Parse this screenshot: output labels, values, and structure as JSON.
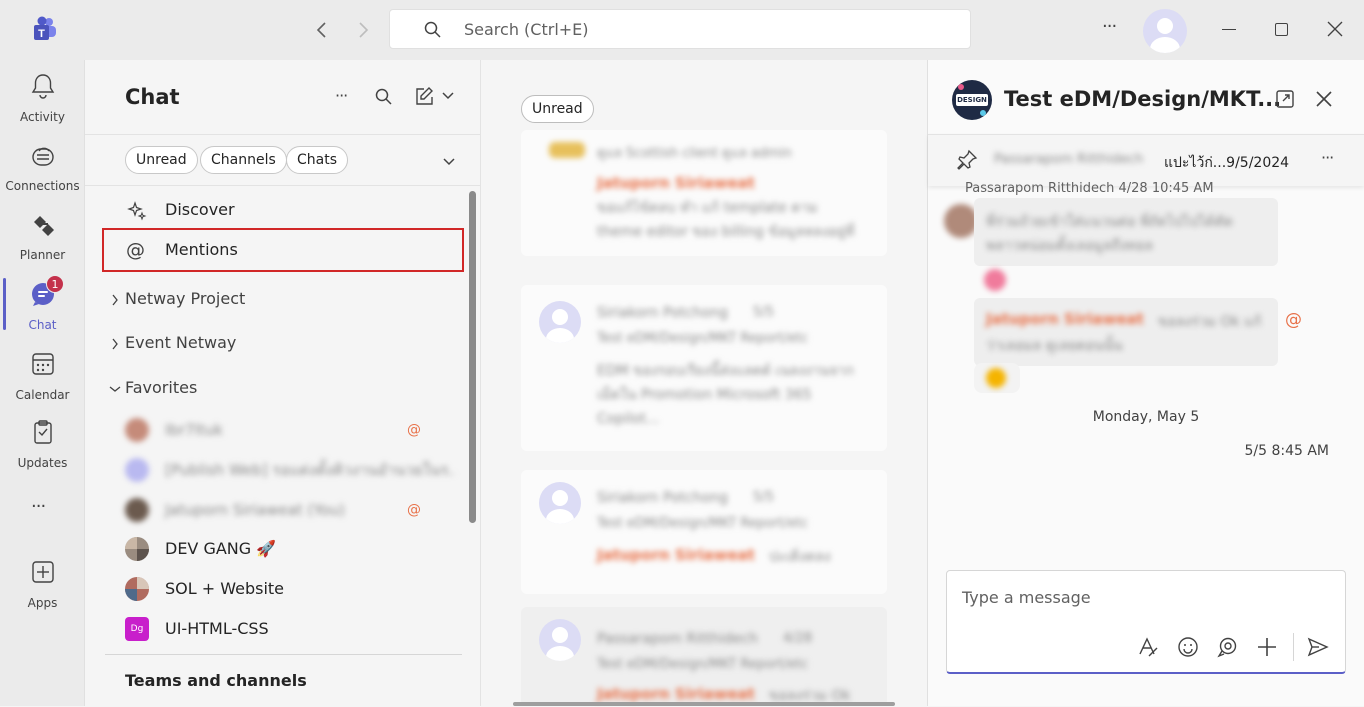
{
  "titlebar": {
    "search_placeholder": "Search (Ctrl+E)",
    "more": "···"
  },
  "rail": {
    "items": [
      {
        "label": "Activity"
      },
      {
        "label": "Connections"
      },
      {
        "label": "Planner"
      },
      {
        "label": "Chat",
        "badge": "1"
      },
      {
        "label": "Calendar"
      },
      {
        "label": "Updates"
      },
      {
        "label": "···"
      },
      {
        "label": "Apps"
      }
    ]
  },
  "chatlist": {
    "title": "Chat",
    "filters": [
      "Unread",
      "Channels",
      "Chats"
    ],
    "discover": "Discover",
    "mentions": "Mentions",
    "groups": [
      {
        "label": "Netway Project"
      },
      {
        "label": "Event Netway"
      },
      {
        "label": "Favorites"
      }
    ],
    "favorites": [
      {
        "name": "Ibr7ltuk",
        "mention": "@"
      },
      {
        "name": "[Publish Web] รอแต่งตั้งคิวงานอำนวยในร...",
        "mention": ""
      },
      {
        "name": "Jatuporn Siriaweat (You)",
        "mention": "@"
      },
      {
        "name": "DEV GANG 🚀",
        "mention": ""
      },
      {
        "name": "SOL + Website",
        "mention": ""
      },
      {
        "name": "UI-HTML-CSS",
        "mention": "",
        "initials": "Dg"
      }
    ],
    "teams_header": "Teams and channels"
  },
  "feed": {
    "unread_chip": "Unread",
    "cards": [
      {
        "sender": "",
        "time": "",
        "channel": "ดูแล Scottish client ดูแล admin",
        "mention_name": "Jatuporn Siriaweat",
        "text": "ขอแก้ไข้ตลบ ทำ แก้ template ตาม theme editor ของ billing ข้อมูลหลงอยู่ที่ domai..."
      },
      {
        "sender": "Siriakorn Potchong",
        "time": "5/5",
        "channel": "Test eDM/Design/MKT Report/etc",
        "mention_name": "Jatuporn Siriaweat",
        "text": "EDM ของรอบเรียงนี้ส่งแลตต์ เนลงงานจาก เม็ดใน Promotion Microsoft 365 Copilot..."
      },
      {
        "sender": "Siriakorn Potchong",
        "time": "5/5",
        "channel": "Test eDM/Design/MKT Report/etc",
        "mention_name": "Jatuporn Siriaweat",
        "text": "ปะเดิ่งตลง"
      },
      {
        "sender": "Passarapom Ritthidech",
        "time": "4/28",
        "channel": "Test eDM/Design/MKT Report/etc",
        "mention_name": "Jatuporn Siriaweat",
        "text": "ขอลงร่วม Ok"
      }
    ]
  },
  "chat": {
    "title": "Test eDM/Design/MKT...",
    "pinned_blurred": "Passarapom Ritthidech",
    "pinned_text": "แปะไว้ก่...9/5/2024",
    "msg_header": "Passarapom Ritthidech  4/28 10:45 AM",
    "msg1": "พี่ร่วมถ้วยเข้าใส่แนวนต่อ พี่ถัดไปไปได้ตัดพลาวหน่อมตั้งเลอมูลถึงทอล",
    "msg2_mention": "Jatuporn Siriaweat",
    "msg2_text": "ขอลงร่วม Ok แก้ว่าเลอมล ดูเลยตอนนั้น",
    "date_divider": "Monday, May 5",
    "timestamp": "5/5 8:45 AM",
    "compose_placeholder": "Type a message"
  },
  "colors": {
    "accent": "#5b5fc7",
    "badge": "#c4314b",
    "mention": "#e8724a",
    "highlight_border": "#d12727"
  }
}
